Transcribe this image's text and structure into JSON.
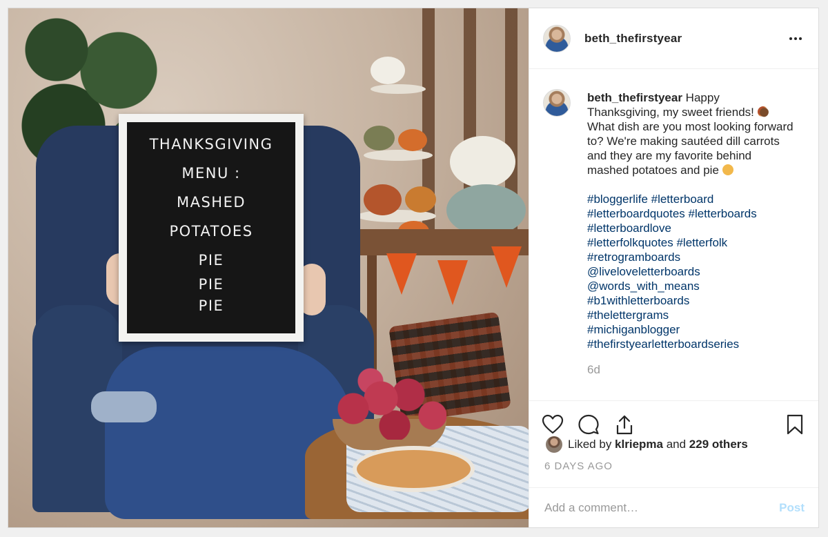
{
  "post": {
    "username": "beth_thefirstyear",
    "letterboard_lines": [
      "THANKSGIVING",
      "MENU :",
      "MASHED",
      "POTATOES",
      "PIE",
      "PIE",
      "PIE"
    ]
  },
  "caption": {
    "username": "beth_thefirstyear",
    "text_part1": "Happy Thanksgiving, my sweet friends! ",
    "text_part2": " What dish are you most looking forward to? We're making sautéed dill carrots and they are my favorite behind mashed potatoes and pie ",
    "tags": [
      "#bloggerlife #letterboard",
      "#letterboardquotes #letterboards",
      "#letterboardlove",
      "#letterfolkquotes #letterfolk",
      "#retrogramboards",
      "@liveloveletterboards",
      "@words_with_means",
      "#b1withletterboards",
      "#thelettergrams",
      "#michiganblogger",
      "#thefirstyearletterboardseries"
    ],
    "time_ago": "6d"
  },
  "likes": {
    "prefix": "Liked by ",
    "user": "klriepma",
    "middle": " and ",
    "others": "229 others"
  },
  "date_label": "6 DAYS AGO",
  "comment": {
    "placeholder": "Add a comment…",
    "post_label": "Post"
  },
  "colors": {
    "link": "#003569",
    "muted": "#999999",
    "post_button_disabled": "#b2dffc"
  },
  "icons": [
    "more-icon",
    "like-icon",
    "comment-icon",
    "share-icon",
    "save-icon",
    "turkey-emoji",
    "yum-emoji"
  ]
}
